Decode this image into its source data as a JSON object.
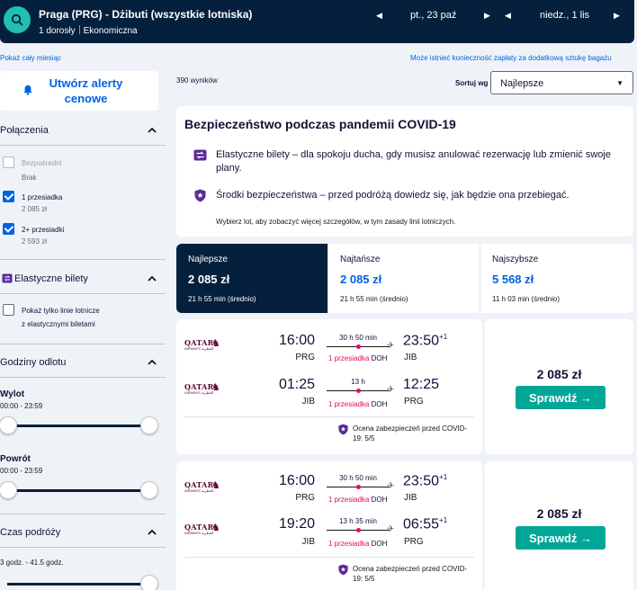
{
  "header": {
    "route": "Praga (PRG) - Dżibuti (wszystkie lotniska)",
    "passengers": "1 dorosły",
    "cabin": "Ekonomiczna",
    "depart_date": "pt., 23 paź",
    "return_date": "niedz., 1 lis"
  },
  "links": {
    "full_month": "Pokaż cały miesiąc",
    "bag_fee": "Może istnieć konieczność zapłaty za dodatkową sztukę bagażu"
  },
  "sidebar": {
    "alert_button": "Utwórz alerty cenowe",
    "stops": {
      "title": "Połączenia",
      "options": [
        {
          "label": "Bezpośredni",
          "sub": "Brak"
        },
        {
          "label": "1 przesiadka",
          "sub": "2 085 zł"
        },
        {
          "label": "2+ przesiadki",
          "sub": "2 593 zł"
        }
      ]
    },
    "flex": {
      "title": "Elastyczne bilety",
      "option_line1": "Pokaż tylko linie lotnicze",
      "option_line2": "z elastycznymi biletami"
    },
    "times": {
      "title": "Godziny odlotu",
      "outbound_label": "Wylot",
      "outbound_range": "00:00 - 23:59",
      "return_label": "Powrót",
      "return_range": "00:00 - 23:59"
    },
    "duration": {
      "title": "Czas podróży",
      "range": "3 godz. - 41.5 godz."
    }
  },
  "results": {
    "count": "390 wyników",
    "sort_label": "Sortuj wg",
    "sort_value": "Najlepsze"
  },
  "covid": {
    "title": "Bezpieczeństwo podczas pandemii COVID-19",
    "item1": "Elastyczne bilety – dla spokoju ducha, gdy musisz anulować rezerwację lub zmienić swoje plany.",
    "item2": "Środki bezpieczeństwa – przed podróżą dowiedz się, jak będzie ona przebiegać.",
    "note": "Wybierz lot, aby zobaczyć więcej szczegółów, w tym zasady linii lotniczych."
  },
  "tabs": [
    {
      "name": "Najlepsze",
      "price": "2 085 zł",
      "time": "21 h 55 min (średnio)"
    },
    {
      "name": "Najtańsze",
      "price": "2 085 zł",
      "time": "21 h 55 min (średnio)"
    },
    {
      "name": "Najszybsze",
      "price": "5 568 zł",
      "time": "11 h 03 min (średnio)"
    }
  ],
  "airline": {
    "logo": "QATAR",
    "logo_sub": "AIRWAYS القطرية"
  },
  "flights": [
    {
      "legs": [
        {
          "dep": "16:00",
          "dep_code": "PRG",
          "dur": "30 h 50 min",
          "stop": "1 przesiadka",
          "via": "DOH",
          "arr": "23:50",
          "plus": "+1",
          "arr_code": "JIB"
        },
        {
          "dep": "01:25",
          "dep_code": "JIB",
          "dur": "13 h",
          "stop": "1 przesiadka",
          "via": "DOH",
          "arr": "12:25",
          "plus": "",
          "arr_code": "PRG"
        }
      ],
      "safety": "Ocena zabezpieczeń przed COVID-19: 5/5",
      "price": "2 085 zł",
      "button": "Sprawdź →"
    },
    {
      "legs": [
        {
          "dep": "16:00",
          "dep_code": "PRG",
          "dur": "30 h 50 min",
          "stop": "1 przesiadka",
          "via": "DOH",
          "arr": "23:50",
          "plus": "+1",
          "arr_code": "JIB"
        },
        {
          "dep": "19:20",
          "dep_code": "JIB",
          "dur": "13 h 35 min",
          "stop": "1 przesiadka",
          "via": "DOH",
          "arr": "06:55",
          "plus": "+1",
          "arr_code": "PRG"
        }
      ],
      "safety": "Ocena zabezpieczeń przed COVID-19: 5/5",
      "price": "2 085 zł",
      "button": "Sprawdź →"
    }
  ]
}
